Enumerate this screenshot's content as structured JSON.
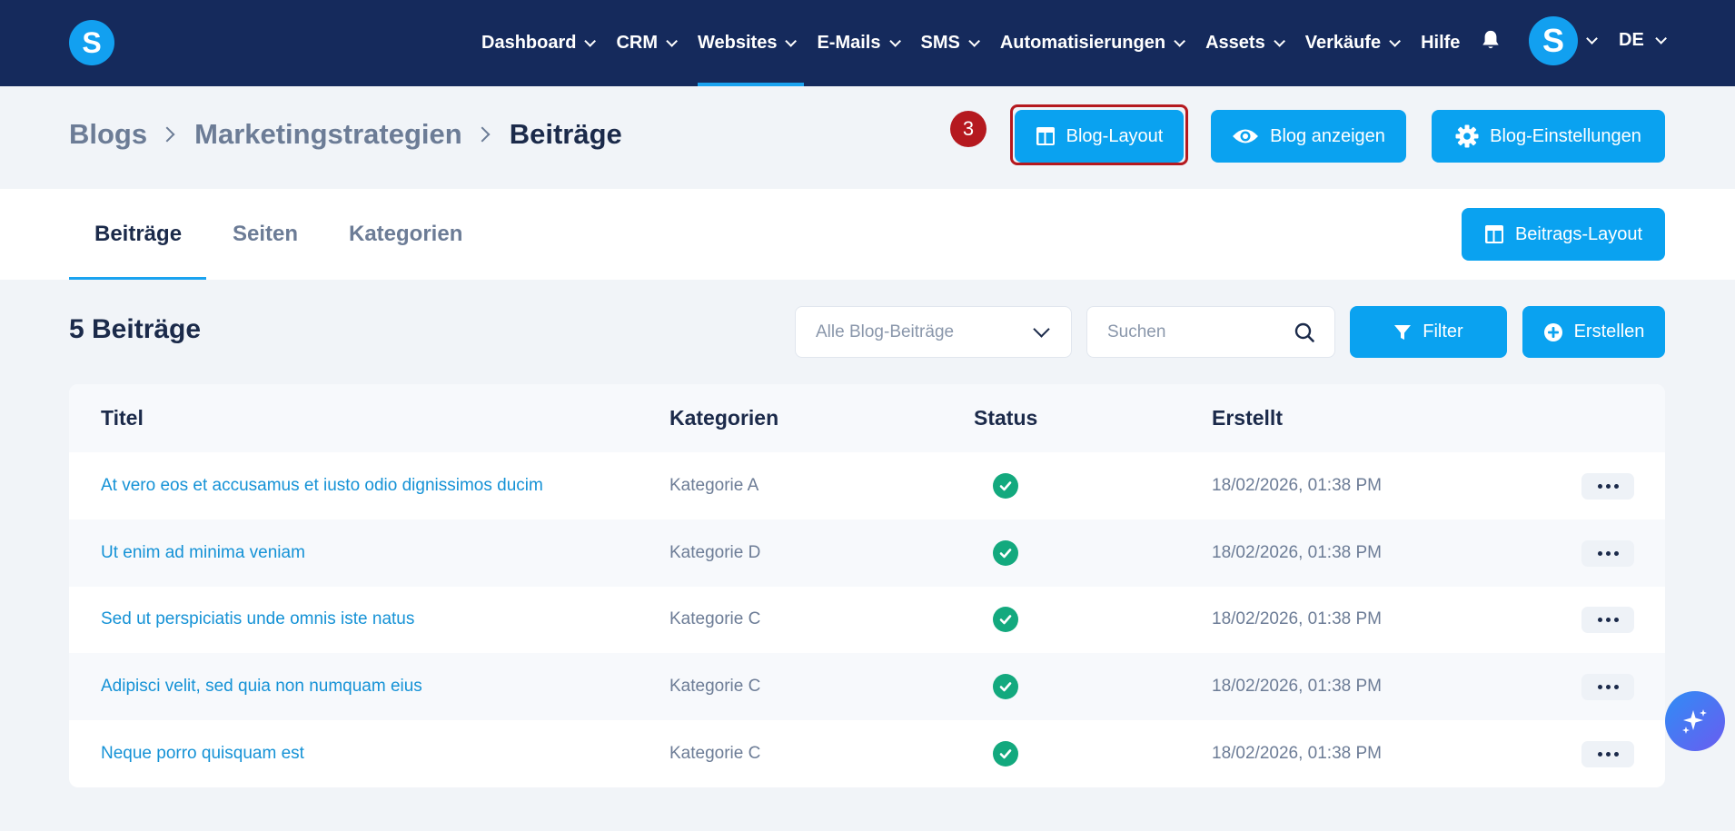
{
  "brand": {
    "logo_letter": "S"
  },
  "topnav": {
    "items": [
      {
        "label": "Dashboard",
        "has_menu": true
      },
      {
        "label": "CRM",
        "has_menu": true
      },
      {
        "label": "Websites",
        "has_menu": true,
        "active": true
      },
      {
        "label": "E-Mails",
        "has_menu": true
      },
      {
        "label": "SMS",
        "has_menu": true
      },
      {
        "label": "Automatisierungen",
        "has_menu": true
      },
      {
        "label": "Assets",
        "has_menu": true
      },
      {
        "label": "Verkäufe",
        "has_menu": true
      },
      {
        "label": "Hilfe",
        "has_menu": false
      }
    ],
    "avatar_letter": "S",
    "language": "DE"
  },
  "breadcrumb": {
    "items": [
      "Blogs",
      "Marketingstrategien",
      "Beiträge"
    ]
  },
  "step_marker": "3",
  "header_actions": {
    "blog_layout": "Blog-Layout",
    "blog_view": "Blog anzeigen",
    "blog_settings": "Blog-Einstellungen"
  },
  "tabs": {
    "items": [
      "Beiträge",
      "Seiten",
      "Kategorien"
    ],
    "active": "Beiträge",
    "post_layout_button": "Beitrags-Layout"
  },
  "list": {
    "count_title": "5 Beiträge",
    "filter_select": {
      "value": "Alle Blog-Beiträge"
    },
    "search": {
      "placeholder": "Suchen",
      "value": ""
    },
    "filter_button": "Filter",
    "create_button": "Erstellen",
    "columns": [
      "Titel",
      "Kategorien",
      "Status",
      "Erstellt"
    ],
    "rows": [
      {
        "title": "At vero eos et accusamus et iusto odio dignissimos ducim",
        "category": "Kategorie A",
        "status": "published",
        "created": "18/02/2026, 01:38 PM"
      },
      {
        "title": "Ut enim ad minima veniam",
        "category": "Kategorie D",
        "status": "published",
        "created": "18/02/2026, 01:38 PM"
      },
      {
        "title": "Sed ut perspiciatis unde omnis iste natus",
        "category": "Kategorie C",
        "status": "published",
        "created": "18/02/2026, 01:38 PM"
      },
      {
        "title": "Adipisci velit, sed quia non numquam eius",
        "category": "Kategorie C",
        "status": "published",
        "created": "18/02/2026, 01:38 PM"
      },
      {
        "title": "Neque porro quisquam est",
        "category": "Kategorie C",
        "status": "published",
        "created": "18/02/2026, 01:38 PM"
      }
    ]
  },
  "colors": {
    "nav_bg": "#152a5c",
    "accent": "#0aa2f0",
    "status_ok": "#13a97e",
    "highlight": "#b5191f"
  },
  "icons": {
    "bell": "bell-icon",
    "layout": "layout-icon",
    "eye": "eye-icon",
    "gear": "gear-icon",
    "search": "search-icon",
    "filter": "filter-icon",
    "plus": "plus-circle-icon",
    "check": "check-circle-icon",
    "more": "more-horizontal-icon",
    "ai": "sparkles-icon"
  }
}
